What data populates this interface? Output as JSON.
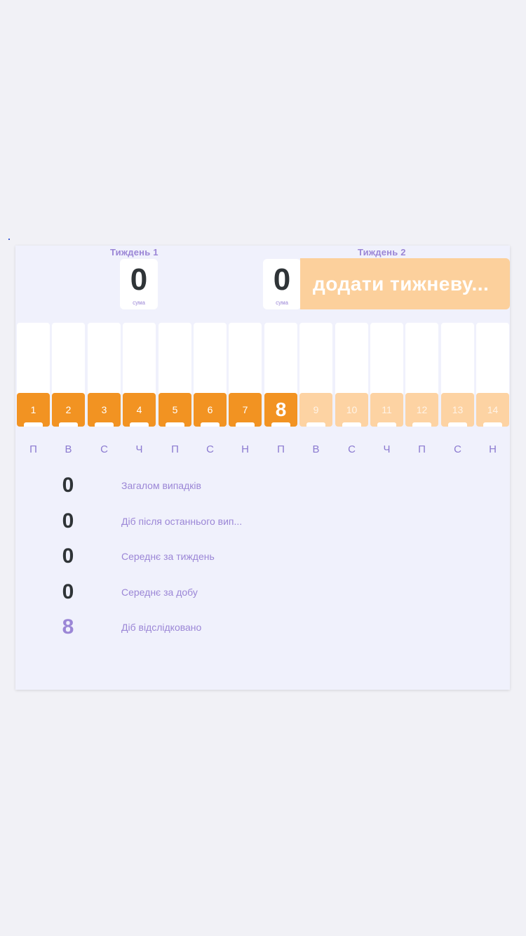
{
  "week1": {
    "title": "Тиждень 1",
    "sum": "0",
    "sum_caption": "сума"
  },
  "week2": {
    "title": "Тиждень 2",
    "sum": "0",
    "sum_caption": "сума",
    "add_button": "додати тижневу..."
  },
  "days": [
    {
      "n": "1",
      "wd": "П",
      "state": "active"
    },
    {
      "n": "2",
      "wd": "В",
      "state": "active"
    },
    {
      "n": "3",
      "wd": "С",
      "state": "active"
    },
    {
      "n": "4",
      "wd": "Ч",
      "state": "active"
    },
    {
      "n": "5",
      "wd": "П",
      "state": "active"
    },
    {
      "n": "6",
      "wd": "С",
      "state": "active"
    },
    {
      "n": "7",
      "wd": "Н",
      "state": "active"
    },
    {
      "n": "8",
      "wd": "П",
      "state": "today"
    },
    {
      "n": "9",
      "wd": "В",
      "state": "inactive"
    },
    {
      "n": "10",
      "wd": "С",
      "state": "inactive"
    },
    {
      "n": "11",
      "wd": "Ч",
      "state": "inactive"
    },
    {
      "n": "12",
      "wd": "П",
      "state": "inactive"
    },
    {
      "n": "13",
      "wd": "С",
      "state": "inactive"
    },
    {
      "n": "14",
      "wd": "Н",
      "state": "inactive"
    }
  ],
  "stats": [
    {
      "value": "0",
      "label": "Загалом випадків"
    },
    {
      "value": "0",
      "label": "Діб після останнього вип..."
    },
    {
      "value": "0",
      "label": "Середнє за тиждень"
    },
    {
      "value": "0",
      "label": "Середнє за добу"
    },
    {
      "value": "8",
      "label": "Діб відслідковано",
      "highlight": true
    }
  ],
  "colors": {
    "active": "#f29322",
    "inactive": "#fdd3a3",
    "accent_text": "#9b86d6",
    "value_text": "#2f3437"
  }
}
